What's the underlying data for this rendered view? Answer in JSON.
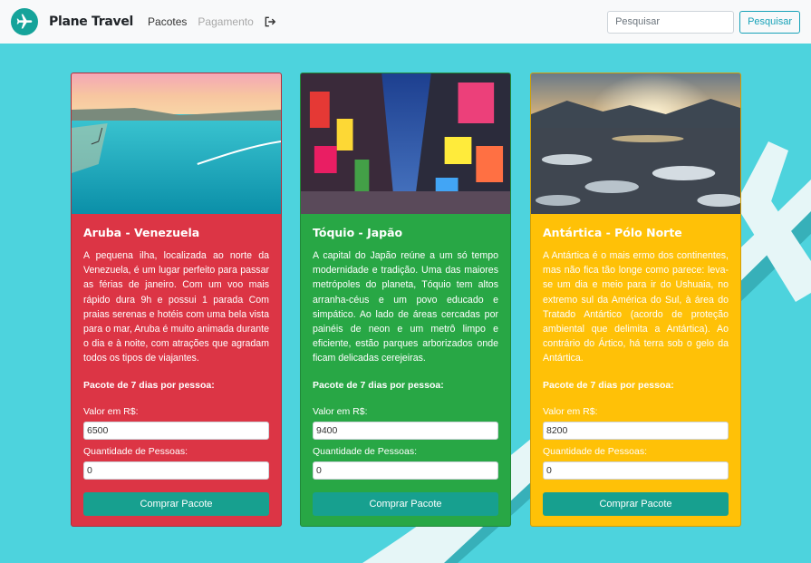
{
  "nav": {
    "brand": "Plane Travel",
    "link_pacotes": "Pacotes",
    "link_pagamento": "Pagamento",
    "search_placeholder": "Pesquisar",
    "search_button": "Pesquisar"
  },
  "cards": [
    {
      "title": "Aruba - Venezuela",
      "description": "A pequena ilha, localizada ao norte da Venezuela, é um lugar perfeito para passar as férias de janeiro. Com um voo mais rápido dura 9h e possui 1 parada Com praias serenas e hotéis com uma bela vista para o mar, Aruba é muito animada durante o dia e à noite, com atrações que agradam todos os tipos de viajantes.",
      "package_label": "Pacote de 7 dias por pessoa:",
      "price_label": "Valor em R$:",
      "price_value": "6500",
      "people_label": "Quantidade de Pessoas:",
      "people_value": "0",
      "button_label": "Comprar Pacote"
    },
    {
      "title": "Tóquio - Japão",
      "description": "A capital do Japão reúne a um só tempo modernidade e tradição. Uma das maiores metrópoles do planeta, Tóquio tem altos arranha-céus e um povo educado e simpático. Ao lado de áreas cercadas por painéis de neon e um metrô limpo e eficiente, estão parques arborizados onde ficam delicadas cerejeiras.",
      "package_label": "Pacote de 7 dias por pessoa:",
      "price_label": "Valor em R$:",
      "price_value": "9400",
      "people_label": "Quantidade de Pessoas:",
      "people_value": "0",
      "button_label": "Comprar Pacote"
    },
    {
      "title": "Antártica - Pólo Norte",
      "description": "A Antártica é o mais ermo dos continentes, mas não fica tão longe como parece: leva-se um dia e meio para ir do Ushuaia, no extremo sul da América do Sul, à área do Tratado Antártico (acordo de proteção ambiental que delimita a Antártica). Ao contrário do Ártico, há terra sob o gelo da Antártica.",
      "package_label": "Pacote de 7 dias por pessoa:",
      "price_label": "Valor em R$:",
      "price_value": "8200",
      "people_label": "Quantidade de Pessoas:",
      "people_value": "0",
      "button_label": "Comprar Pacote"
    }
  ]
}
